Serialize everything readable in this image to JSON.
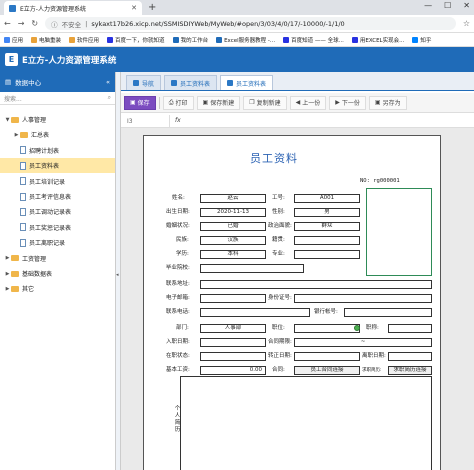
{
  "browser": {
    "tab_title": "E立方-人力资源管理系统",
    "url_security": "不安全",
    "url": "sykaxt17b26.xicp.net/SSMISDIYWeb/MyWeb/#open/3/03/4/0/17/-10000/-1/1/0",
    "bookmarks": [
      "应用",
      "电脑重装",
      "软件应用",
      "百度一下，你就知道",
      "我的工作台",
      "Excel服务器教程 -...",
      "百度知道 —— 全球...",
      "用EXCEL实现会...",
      "知乎"
    ]
  },
  "app": {
    "title": "E立方-人力资源管理系统",
    "logo": "E"
  },
  "sidebar": {
    "header": "数据中心",
    "search_placeholder": "搜索...",
    "items": [
      {
        "label": "人事管理",
        "type": "folder",
        "level": 0,
        "expanded": true
      },
      {
        "label": "汇总表",
        "type": "folder",
        "level": 1,
        "expanded": false
      },
      {
        "label": "招聘计划表",
        "type": "doc",
        "level": 1
      },
      {
        "label": "员工资料表",
        "type": "doc",
        "level": 1,
        "selected": true
      },
      {
        "label": "员工培训记录",
        "type": "doc",
        "level": 1
      },
      {
        "label": "员工考评信息表",
        "type": "doc",
        "level": 1
      },
      {
        "label": "员工调动记录表",
        "type": "doc",
        "level": 1
      },
      {
        "label": "员工奖惩记录表",
        "type": "doc",
        "level": 1
      },
      {
        "label": "员工离职记录",
        "type": "doc",
        "level": 1
      },
      {
        "label": "工资管理",
        "type": "folder",
        "level": 0,
        "expanded": false
      },
      {
        "label": "基础数据表",
        "type": "folder",
        "level": 0,
        "expanded": false
      },
      {
        "label": "其它",
        "type": "folder",
        "level": 0,
        "expanded": false
      }
    ]
  },
  "tabs": [
    {
      "label": "导航"
    },
    {
      "label": "员工资料表"
    },
    {
      "label": "员工资料表",
      "active": true
    }
  ],
  "toolbar": {
    "save": "保存",
    "print": "打印",
    "save_new": "保存新建",
    "copy_new": "复制新建",
    "prev": "上一份",
    "next": "下一份",
    "save_as": "另存为"
  },
  "fx": {
    "cell": "I3",
    "fx": "fx"
  },
  "form": {
    "title": "员工资料",
    "no_label": "NO: rg000001",
    "fields": {
      "name_l": "姓名:",
      "name_v": "赵云",
      "empno_l": "工号:",
      "empno_v": "A001",
      "birth_l": "出生日期:",
      "birth_v": "2020-11-13",
      "gender_l": "性别:",
      "gender_v": "男",
      "marital_l": "婚姻状况:",
      "marital_v": "已婚",
      "political_l": "政治面貌:",
      "political_v": "群众",
      "ethnic_l": "民族:",
      "ethnic_v": "汉族",
      "native_l": "籍贯:",
      "native_v": "",
      "edu_l": "学历:",
      "edu_v": "本科",
      "major_l": "专业:",
      "major_v": "",
      "school_l": "毕业院校:",
      "school_v": "",
      "address_l": "联系地址:",
      "address_v": "",
      "email_l": "电子邮箱:",
      "email_v": "",
      "idcard_l": "身份证号:",
      "idcard_v": "",
      "phone_l": "联系电话:",
      "phone_v": "",
      "bank_l": "银行帐号:",
      "bank_v": "",
      "dept_l": "部门:",
      "dept_v": "人事部",
      "pos_l": "职位:",
      "pos_v": "",
      "title_l": "职称:",
      "title_v": "",
      "hire_l": "入职日期:",
      "hire_v": "",
      "contract_l": "合同期限:",
      "contract_v": "~",
      "status_l": "在职状态:",
      "status_v": "",
      "regular_l": "转正日期:",
      "regular_v": "",
      "leave_l": "离职日期:",
      "leave_v": "",
      "salary_l": "基本工资:",
      "salary_v": "0.00",
      "contract2_l": "合同:",
      "contract2_v": "员工合同连接",
      "request_l": "求职简历:",
      "request_v": "求职简历连接",
      "resume_l": "个人简历"
    }
  }
}
